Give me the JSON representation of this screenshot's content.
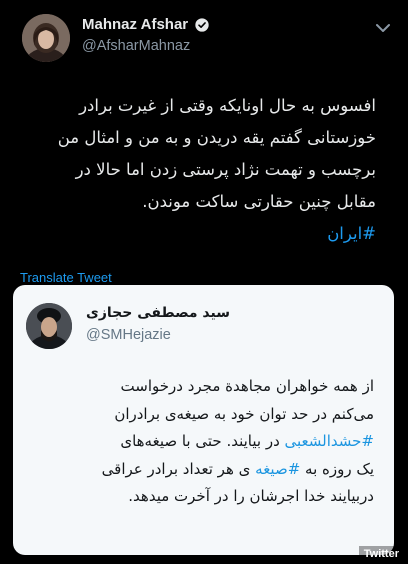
{
  "tweet": {
    "display_name": "Mahnaz Afshar",
    "handle": "@AfsharMahnaz",
    "verified": true,
    "body_lines": [
      "افسوس به حال اونایکه وقتی از غیرت برادر",
      "خوزستانی گفتم یقه دریدن و به من و امثال من",
      "برچسب و تهمت نژاد پرستی زدن اما حالا در",
      "مقابل چنین حقارتی ساکت موندن."
    ],
    "hashtag": "#ایران",
    "translate_label": "Translate Tweet",
    "icons": {
      "verified": "verified-badge-icon",
      "menu": "chevron-down-icon"
    },
    "colors": {
      "background": "#000000",
      "link": "#1d9bf0",
      "secondary_text": "#8b98a5"
    }
  },
  "quoted": {
    "display_name": "سید مصطفی حجازی",
    "handle": "@SMHejazie",
    "body_lines": [
      [
        {
          "t": "از همه خواهران مجاهدة مجرد درخواست"
        }
      ],
      [
        {
          "t": "می‌کنم در حد توان خود به صیغه‌ی برادران"
        }
      ],
      [
        {
          "t": "#حشدالشعبی",
          "tag": true
        },
        {
          "t": " در بیایند. حتی با صیغه‌های"
        }
      ],
      [
        {
          "t": "یک روزه به "
        },
        {
          "t": "#صیغه",
          "tag": true
        },
        {
          "t": " ی هر تعداد برادر عراقی"
        }
      ],
      [
        {
          "t": "دربیایند خدا اجرشان را در آخرت میدهد."
        }
      ]
    ],
    "colors": {
      "card_background": "#f5f8fa",
      "link": "#1b95e0"
    }
  },
  "watermark": "Twitter"
}
